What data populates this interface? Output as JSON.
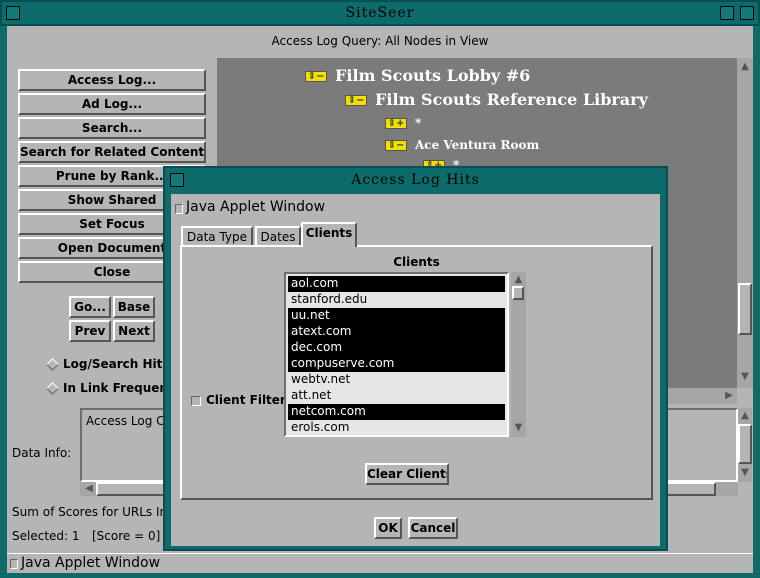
{
  "main_window": {
    "title": "SiteSeer",
    "query_title": "Access Log Query: All Nodes in View",
    "buttons": [
      "Access Log...",
      "Ad Log...",
      "Search...",
      "Search for Related Content...",
      "Prune by Rank...",
      "Show Shared",
      "Set Focus",
      "Open Document",
      "Close"
    ],
    "nav": {
      "go": "Go...",
      "base": "Base",
      "prev": "Prev",
      "next": "Next"
    },
    "radio_log_search": "Log/Search Hits",
    "radio_link_freq": "In Link Frequenc",
    "data_info_label": "Data Info:",
    "data_info_text": "Access Log C",
    "sum_scores": "Sum of Scores for URLs In",
    "selected": "Selected: 1",
    "score": "[Score = 0]",
    "status": "Java Applet Window",
    "tree": [
      {
        "label": "Film Scouts Lobby #6",
        "icon": "collapse-icon"
      },
      {
        "label": "Film Scouts Reference Library",
        "icon": "collapse-icon"
      },
      {
        "label": "*",
        "icon": "expand-icon"
      },
      {
        "label": "Ace Ventura Room",
        "icon": "collapse-icon"
      },
      {
        "label": "*",
        "icon": "expand-icon"
      }
    ]
  },
  "dialog": {
    "title": "Access Log Hits",
    "applet_label": "Java Applet Window",
    "tabs": [
      "Data Type",
      "Dates",
      "Clients"
    ],
    "active_tab": "Clients",
    "clients_heading": "Clients",
    "client_filter_label": "Client Filter",
    "clients": [
      {
        "name": "aol.com",
        "selected": true
      },
      {
        "name": "stanford.edu",
        "selected": false
      },
      {
        "name": "uu.net",
        "selected": true
      },
      {
        "name": "atext.com",
        "selected": true
      },
      {
        "name": "dec.com",
        "selected": true
      },
      {
        "name": "compuserve.com",
        "selected": true
      },
      {
        "name": "webtv.net",
        "selected": false
      },
      {
        "name": "att.net",
        "selected": false
      },
      {
        "name": "netcom.com",
        "selected": true
      },
      {
        "name": "erols.com",
        "selected": false
      }
    ],
    "clear_clients": "Clear Clients",
    "ok": "OK",
    "cancel": "Cancel"
  }
}
